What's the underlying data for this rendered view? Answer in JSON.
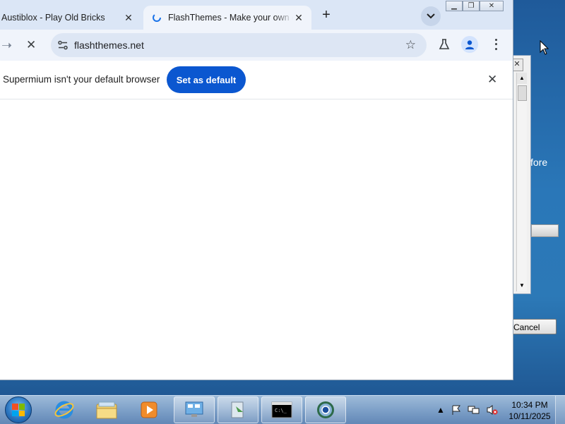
{
  "browser": {
    "tabs": [
      {
        "title": "Austiblox - Play Old Bricks",
        "active": false
      },
      {
        "title": "FlashThemes - Make your own c",
        "active": true
      }
    ],
    "new_tab_label": "+",
    "address": "flashthemes.net",
    "infobar": {
      "message": "Supermium isn't your default browser",
      "button_label": "Set as default"
    },
    "icons": [
      "arrow-right-icon",
      "stop-icon",
      "site-info-icon",
      "star-icon",
      "labs-flask-icon",
      "profile-icon",
      "kebab-menu-icon",
      "close-icon",
      "tab-search-icon"
    ]
  },
  "background_dialog": {
    "partial_text": "fore",
    "cancel_label": "Cancel"
  },
  "taskbar": {
    "items": [
      "start-orb",
      "internet-explorer",
      "windows-explorer",
      "media-player",
      "control-panel",
      "file-transfer",
      "command-prompt",
      "supermium"
    ],
    "clock": {
      "time": "10:34 PM",
      "date": "10/11/2025"
    }
  },
  "colors": {
    "accent": "#0b57d0",
    "tabstrip": "#dbe6f6",
    "toolbar": "#f0f4fb",
    "desktop": "#2a77b8"
  }
}
